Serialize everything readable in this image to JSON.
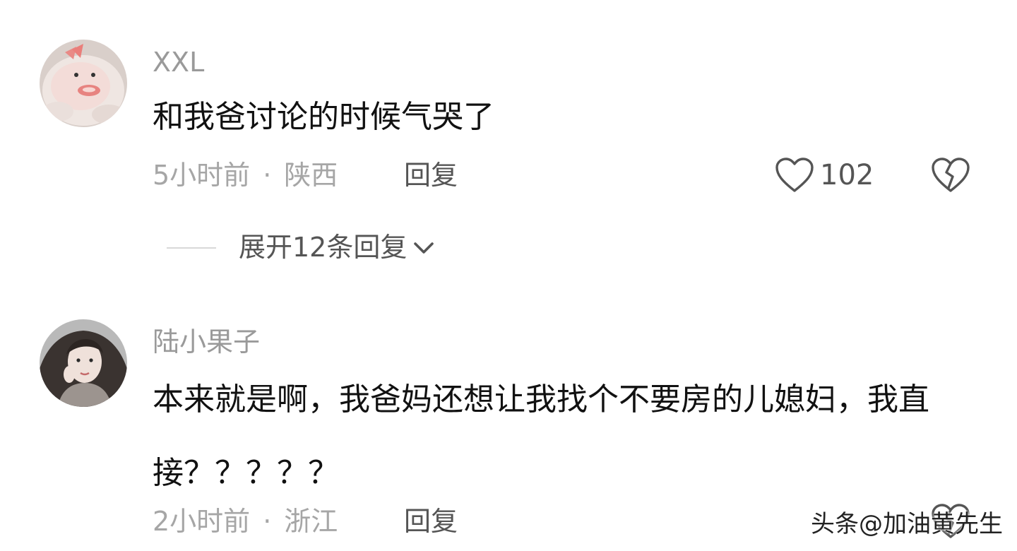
{
  "comments": [
    {
      "username": "XXL",
      "text": "和我爸讨论的时候气哭了",
      "time": "5小时前",
      "separator": "·",
      "location": "陕西",
      "reply_label": "回复",
      "likes": "102"
    },
    {
      "username": "陆小果子",
      "text": "本来就是啊，我爸妈还想让我找个不要房的儿媳妇，我直接？？？？？",
      "time": "2小时前",
      "separator": "·",
      "location": "浙江",
      "reply_label": "回复"
    }
  ],
  "expand_replies": {
    "label": "展开12条回复"
  },
  "watermark": "头条@加油黄先生",
  "colors": {
    "username": "#9a9a9a",
    "text": "#111111",
    "meta": "#a6a6a6",
    "action": "#555555"
  },
  "icons": {
    "like": "heart-outline-icon",
    "dislike": "broken-heart-icon",
    "expand": "chevron-down-icon"
  }
}
